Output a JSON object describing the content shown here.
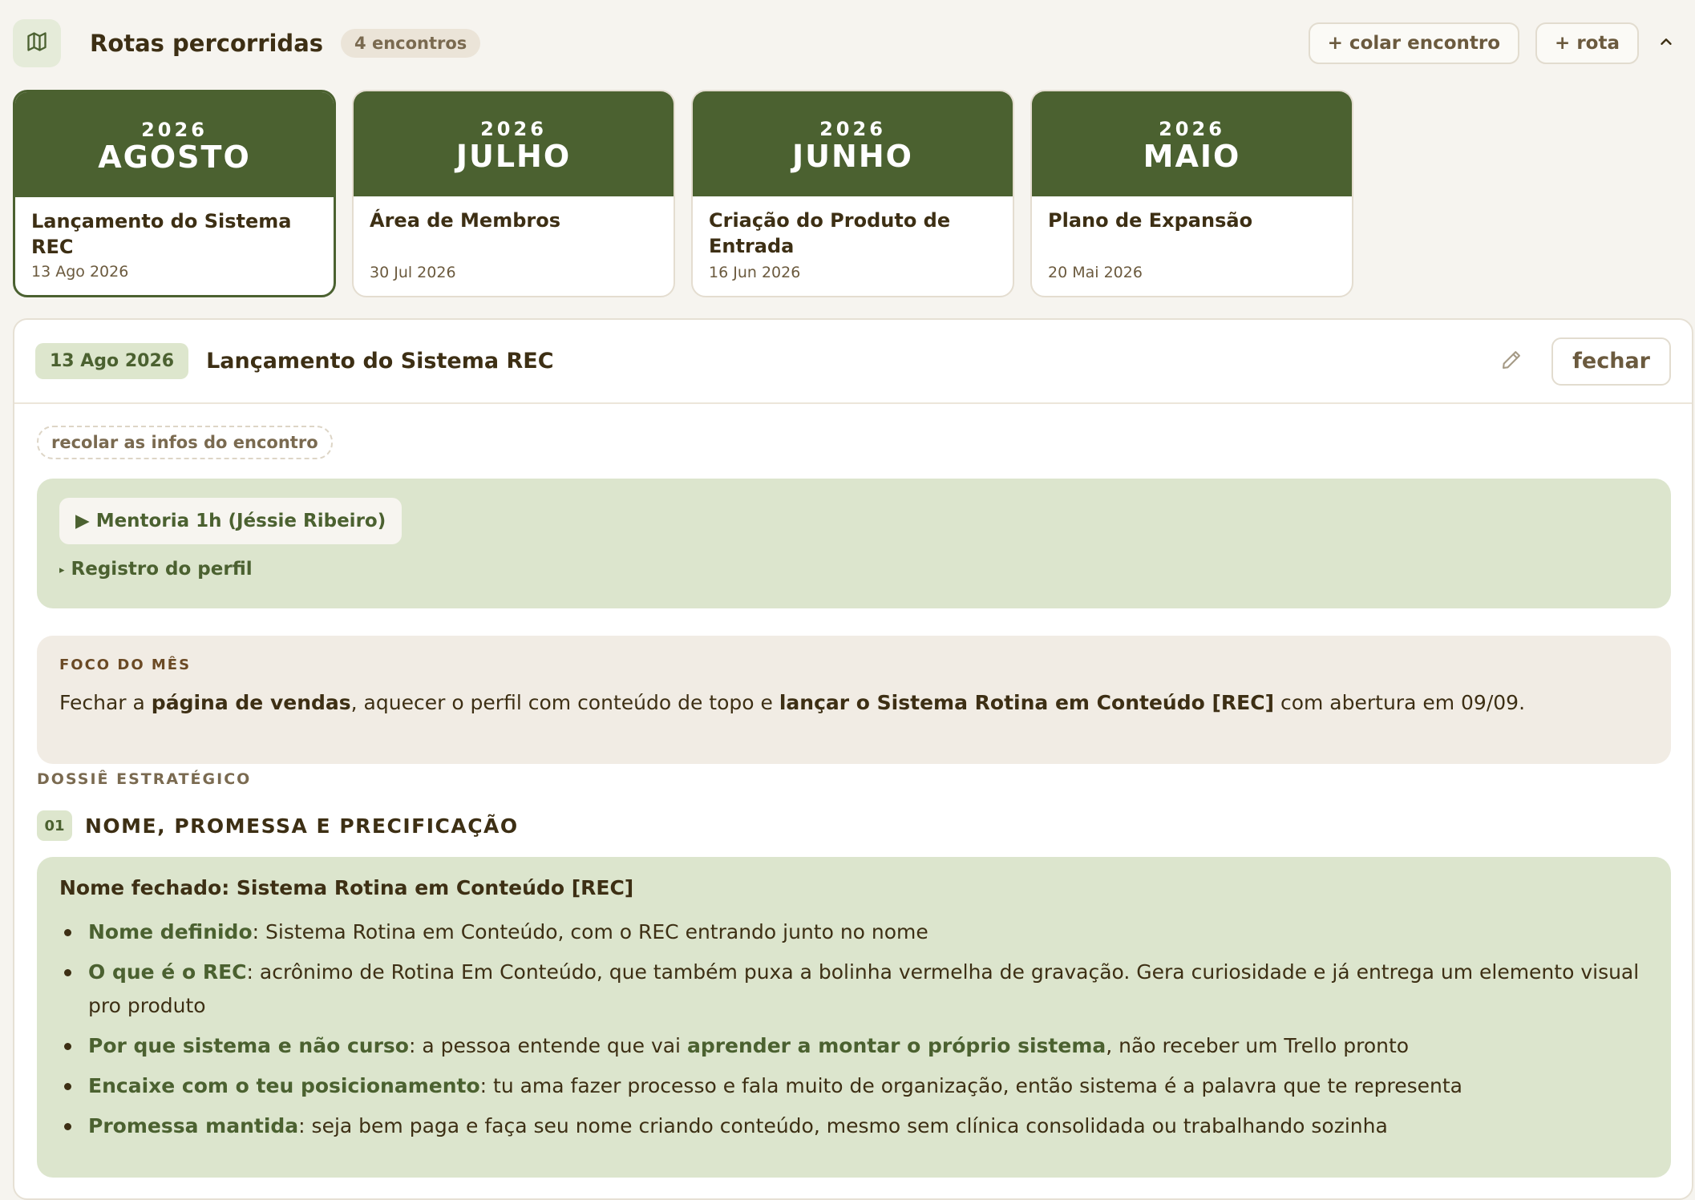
{
  "header": {
    "title": "Rotas percorridas",
    "count_badge": "4 encontros",
    "paste_button": "+ colar encontro",
    "route_button": "+ rota"
  },
  "icons": {
    "map": "map-icon",
    "collapse": "chevron-up-icon",
    "edit": "pencil-icon"
  },
  "colors": {
    "brand_green": "#4b6130",
    "light_green": "#dce5cd",
    "background": "#f6f4ef",
    "text_brown": "#3d2f14"
  },
  "cards": [
    {
      "year": "2026",
      "month": "AGOSTO",
      "title": "Lançamento do Sistema REC",
      "date": "13 Ago 2026",
      "active": true
    },
    {
      "year": "2026",
      "month": "JULHO",
      "title": "Área de Membros",
      "date": "30 Jul 2026",
      "active": false
    },
    {
      "year": "2026",
      "month": "JUNHO",
      "title": "Criação do Produto de Entrada",
      "date": "16 Jun 2026",
      "active": false
    },
    {
      "year": "2026",
      "month": "MAIO",
      "title": "Plano de Expansão",
      "date": "20 Mai 2026",
      "active": false
    }
  ],
  "detail": {
    "date_badge": "13 Ago 2026",
    "title": "Lançamento do Sistema REC",
    "close_button": "fechar",
    "recolar_button": "recolar as infos do encontro",
    "mentoria_button": "▶ Mentoria 1h (Jéssie Ribeiro)",
    "registro_link": "Registro do perfil",
    "registro_marker": "▸",
    "foco": {
      "label": "FOCO DO MÊS",
      "p1": "Fechar a ",
      "b1": "página de vendas",
      "p2": ", aquecer o perfil com conteúdo de topo e ",
      "b2": "lançar o Sistema Rotina em Conteúdo [REC]",
      "p3": " com abertura em 09/09."
    },
    "dossie_label": "DOSSIÊ ESTRATÉGICO",
    "section": {
      "number": "01",
      "title": "NOME, PROMESSA E PRECIFICAÇÃO",
      "heading": "Nome fechado: Sistema Rotina em Conteúdo [REC]",
      "bullets": [
        {
          "key": "Nome definido",
          "text": ": Sistema Rotina em Conteúdo, com o REC entrando junto no nome"
        },
        {
          "key": "O que é o REC",
          "text": ": acrônimo de Rotina Em Conteúdo, que também puxa a bolinha vermelha de gravação. Gera curiosidade e já entrega um elemento visual pro produto"
        },
        {
          "key": "Por que sistema e não curso",
          "text": ": a pessoa entende que vai ",
          "key2": "aprender a montar o próprio sistema",
          "text2": ", não receber um Trello pronto"
        },
        {
          "key": "Encaixe com o teu posicionamento",
          "text": ": tu ama fazer processo e fala muito de organização, então sistema é a palavra que te representa"
        },
        {
          "key": "Promessa mantida",
          "text": ": seja bem paga e faça seu nome criando conteúdo, mesmo sem clínica consolidada ou trabalhando sozinha"
        }
      ]
    }
  }
}
